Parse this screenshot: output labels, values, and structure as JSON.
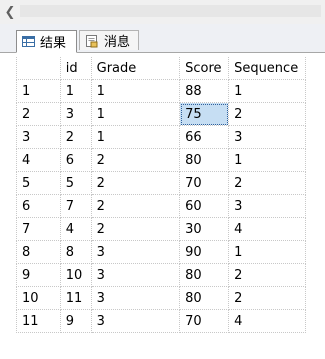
{
  "tabs": [
    {
      "label": "结果",
      "icon": "grid-icon",
      "active": true
    },
    {
      "label": "消息",
      "icon": "messages-icon",
      "active": false
    }
  ],
  "grid": {
    "columns": [
      "id",
      "Grade",
      "Score",
      "Sequence"
    ],
    "rows": [
      {
        "num": "1",
        "id": "1",
        "grade": "1",
        "score": "88",
        "sequence": "1"
      },
      {
        "num": "2",
        "id": "3",
        "grade": "1",
        "score": "75",
        "sequence": "2"
      },
      {
        "num": "3",
        "id": "2",
        "grade": "1",
        "score": "66",
        "sequence": "3"
      },
      {
        "num": "4",
        "id": "6",
        "grade": "2",
        "score": "80",
        "sequence": "1"
      },
      {
        "num": "5",
        "id": "5",
        "grade": "2",
        "score": "70",
        "sequence": "2"
      },
      {
        "num": "6",
        "id": "7",
        "grade": "2",
        "score": "60",
        "sequence": "3"
      },
      {
        "num": "7",
        "id": "4",
        "grade": "2",
        "score": "30",
        "sequence": "4"
      },
      {
        "num": "8",
        "id": "8",
        "grade": "3",
        "score": "90",
        "sequence": "1"
      },
      {
        "num": "9",
        "id": "10",
        "grade": "3",
        "score": "80",
        "sequence": "2"
      },
      {
        "num": "10",
        "id": "11",
        "grade": "3",
        "score": "80",
        "sequence": "2"
      },
      {
        "num": "11",
        "id": "9",
        "grade": "3",
        "score": "70",
        "sequence": "4"
      }
    ],
    "selected_cell": {
      "row": 2,
      "column": "Score"
    }
  },
  "colors": {
    "selection": "#c6def3",
    "tab_strip": "#eef0f4"
  }
}
